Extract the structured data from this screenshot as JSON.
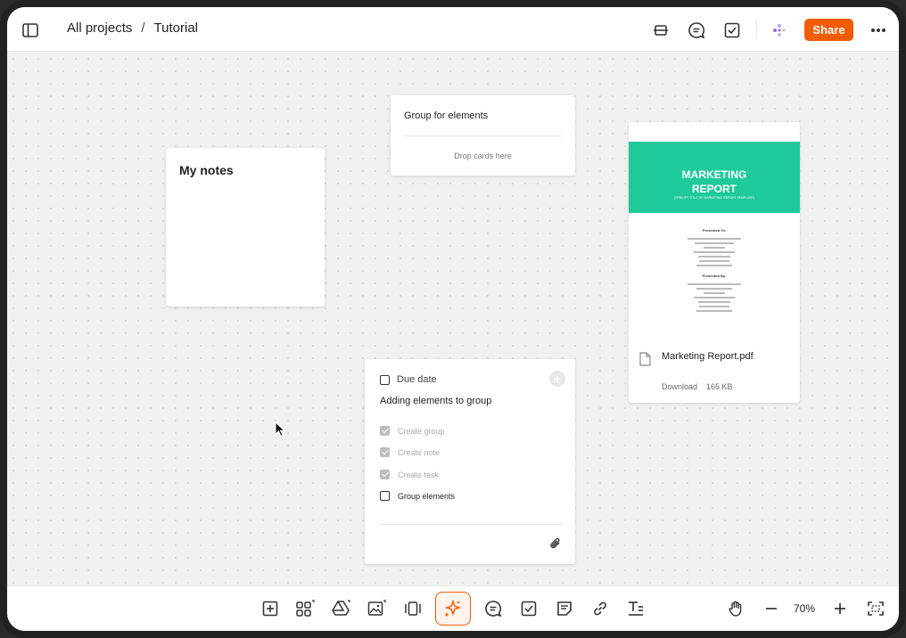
{
  "header": {
    "breadcrumb": [
      "All projects",
      "Tutorial"
    ],
    "breadcrumb_separator": "/",
    "share_label": "Share",
    "icons": [
      "sidebar-toggle-icon",
      "presentation-icon",
      "comments-icon",
      "tasks-icon",
      "ai-assistant-icon",
      "more-icon"
    ]
  },
  "canvas": {
    "notes_card": {
      "title": "My notes"
    },
    "group_card": {
      "title": "Group for elements",
      "drop_hint": "Drop cards here"
    },
    "file_card": {
      "cover_title_line1": "MARKETING",
      "cover_title_line2": "REPORT",
      "cover_subtitle": "[SPECIFY TITLE OF MARKETING REPORT TEMPLATE]",
      "presented_to": "Presented To:",
      "presented_by": "Presented By:",
      "file_name": "Marketing Report.pdf",
      "download_label": "Download",
      "file_size": "165 KB"
    },
    "task_card": {
      "due_date_label": "Due date",
      "title": "Adding elements to group",
      "items": [
        {
          "label": "Create group",
          "checked": true
        },
        {
          "label": "Create note",
          "checked": true
        },
        {
          "label": "Create task",
          "checked": true
        },
        {
          "label": "Group elements",
          "checked": false
        }
      ]
    }
  },
  "toolbar": {
    "tools": [
      "add-card-icon",
      "apps-icon",
      "google-drive-icon",
      "image-icon",
      "carousel-icon",
      "ai-magic-icon",
      "comment-icon",
      "task-icon",
      "note-icon",
      "link-icon",
      "text-icon"
    ],
    "zoom_level": "70%",
    "accent_color": "#f25c05"
  },
  "colors": {
    "accent": "#f25c05",
    "report_cover": "#1ec99a"
  }
}
